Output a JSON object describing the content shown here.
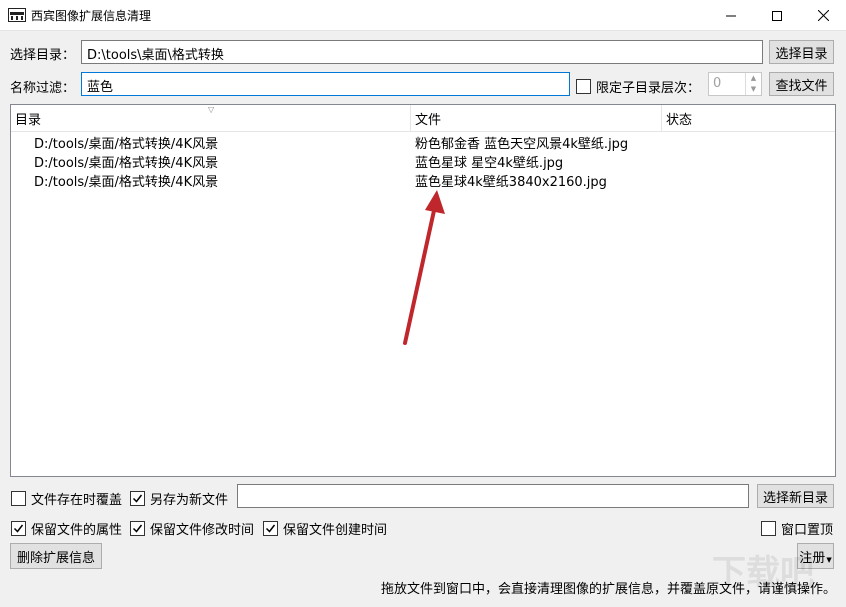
{
  "window": {
    "title": "西宾图像扩展信息清理",
    "app_icon": "app-icon",
    "controls": [
      "minimize-icon",
      "maximize-icon",
      "close-icon"
    ]
  },
  "dir_row": {
    "label": "选择目录：",
    "value": "D:\\tools\\桌面\\格式转换",
    "button": "选择目录"
  },
  "filter_row": {
    "label": "名称过滤：",
    "value": "蓝色",
    "limit_checkbox_label": "限定子目录层次：",
    "limit_checked": false,
    "depth_value": "0",
    "button": "查找文件"
  },
  "list": {
    "columns": [
      "目录",
      "文件",
      "状态"
    ],
    "rows": [
      {
        "dir": "D:/tools/桌面/格式转换/4K风景",
        "file": "粉色郁金香 蓝色天空风景4k壁纸.jpg",
        "status": ""
      },
      {
        "dir": "D:/tools/桌面/格式转换/4K风景",
        "file": "蓝色星球 星空4k壁纸.jpg",
        "status": ""
      },
      {
        "dir": "D:/tools/桌面/格式转换/4K风景",
        "file": "蓝色星球4k壁纸3840x2160.jpg",
        "status": ""
      }
    ]
  },
  "options_row1": {
    "overwrite_label": "文件存在时覆盖",
    "overwrite_checked": false,
    "saveas_label": "另存为新文件",
    "saveas_checked": true,
    "new_dir_value": "",
    "button": "选择新目录"
  },
  "options_row2": {
    "keep_attr_label": "保留文件的属性",
    "keep_attr_checked": true,
    "keep_mtime_label": "保留文件修改时间",
    "keep_mtime_checked": true,
    "keep_ctime_label": "保留文件创建时间",
    "keep_ctime_checked": true,
    "topmost_label": "窗口置顶",
    "topmost_checked": false
  },
  "actions": {
    "delete_button": "删除扩展信息",
    "register_button": "注册"
  },
  "status_text": "拖放文件到窗口中，会直接清理图像的扩展信息，并覆盖原文件，请谨慎操作。",
  "watermark": "下载吧",
  "colors": {
    "annotation_arrow": "#c0272d",
    "focus_border": "#0078d7"
  }
}
